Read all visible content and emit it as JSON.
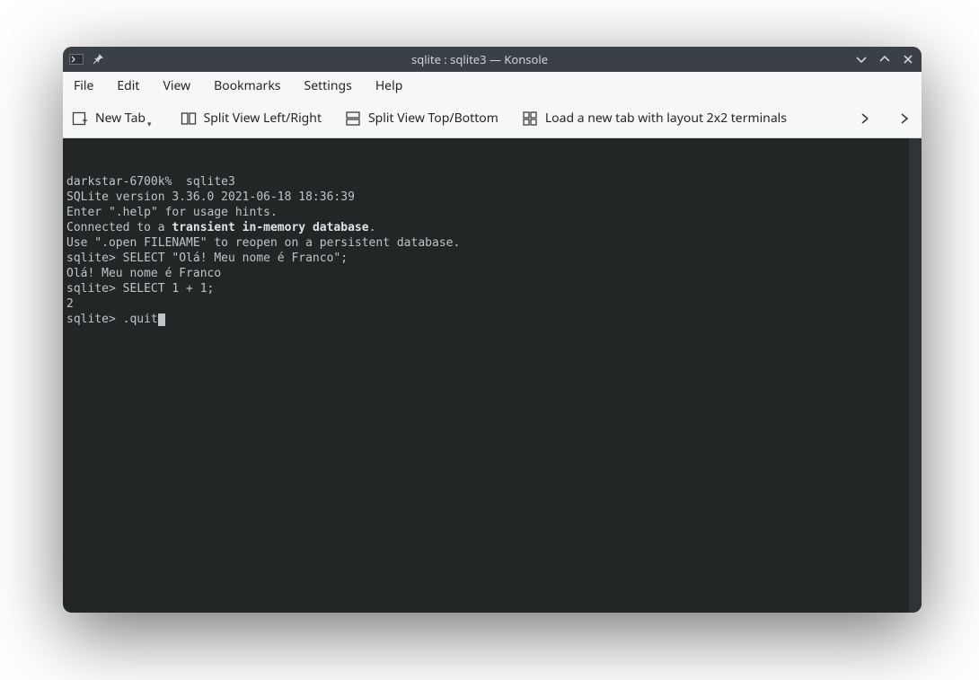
{
  "titlebar": {
    "title": "sqlite : sqlite3 — Konsole"
  },
  "menubar": {
    "items": [
      "File",
      "Edit",
      "View",
      "Bookmarks",
      "Settings",
      "Help"
    ]
  },
  "toolbar": {
    "new_tab": "New Tab",
    "split_lr": "Split View Left/Right",
    "split_tb": "Split View Top/Bottom",
    "load_layout": "Load a new tab with layout 2x2 terminals"
  },
  "terminal": {
    "lines": [
      {
        "pre": "darkstar-6700k%  sqlite3"
      },
      {
        "pre": "SQLite version 3.36.0 2021-06-18 18:36:39"
      },
      {
        "pre": "Enter \".help\" for usage hints."
      },
      {
        "pre": "Connected to a ",
        "bold": "transient in-memory database",
        "post": "."
      },
      {
        "pre": "Use \".open FILENAME\" to reopen on a persistent database."
      },
      {
        "pre": "sqlite> SELECT \"Olá! Meu nome é Franco\";"
      },
      {
        "pre": "Olá! Meu nome é Franco"
      },
      {
        "pre": "sqlite> SELECT 1 + 1;"
      },
      {
        "pre": "2"
      },
      {
        "pre": "sqlite> .quit",
        "cursor": true
      }
    ]
  }
}
